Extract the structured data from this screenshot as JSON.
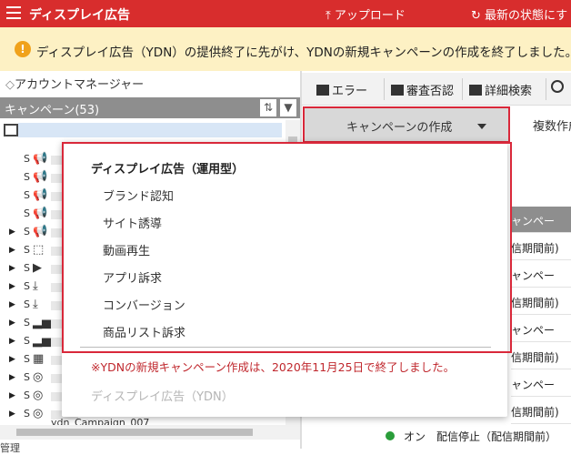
{
  "header": {
    "title": "ディスプレイ広告",
    "upload_label": "アップロード",
    "refresh_label": "最新の状態にす"
  },
  "notice": {
    "text": "ディスプレイ広告（YDN）の提供終了に先がけ、YDNの新規キャンペーンの作成を終了しました。入"
  },
  "sidebar": {
    "account_label": "アカウントマネージャー",
    "campaigns_label": "キャンペーン(53)",
    "footer_label": "管理"
  },
  "tree_rows": [
    {
      "expand": "",
      "prefix": "S",
      "icon": "megaphone"
    },
    {
      "expand": "",
      "prefix": "S",
      "icon": "megaphone"
    },
    {
      "expand": "",
      "prefix": "S",
      "icon": "megaphone"
    },
    {
      "expand": "",
      "prefix": "S",
      "icon": "megaphone"
    },
    {
      "expand": "▶",
      "prefix": "S",
      "icon": "megaphone"
    },
    {
      "expand": "▶",
      "prefix": "S",
      "icon": "cursor"
    },
    {
      "expand": "▶",
      "prefix": "S",
      "icon": "play"
    },
    {
      "expand": "▶",
      "prefix": "S",
      "icon": "download"
    },
    {
      "expand": "▶",
      "prefix": "S",
      "icon": "download"
    },
    {
      "expand": "▶",
      "prefix": "S",
      "icon": "bar-chart"
    },
    {
      "expand": "▶",
      "prefix": "S",
      "icon": "bar-chart"
    },
    {
      "expand": "▶",
      "prefix": "S",
      "icon": "grid"
    },
    {
      "expand": "▶",
      "prefix": "S",
      "icon": "target"
    },
    {
      "expand": "▶",
      "prefix": "S",
      "icon": "target"
    },
    {
      "expand": "▶",
      "prefix": "S",
      "icon": "target"
    }
  ],
  "tree_last_label": "ydn_Campaign_007",
  "toolbar": {
    "error_label": "エラー",
    "review_label": "審査否認",
    "detail_search_label": "詳細検索"
  },
  "create_button": {
    "label": "キャンペーンの作成"
  },
  "multi_label": "複数作成",
  "right_column": [
    {
      "text": "ャンペー",
      "header": true
    },
    {
      "text": "信期間前)",
      "header": false
    },
    {
      "text": "ャンペー",
      "header": false
    },
    {
      "text": "信期間前)",
      "header": false
    },
    {
      "text": "ャンペー",
      "header": false
    },
    {
      "text": "信期間前)",
      "header": false
    },
    {
      "text": "ャンペー",
      "header": false
    },
    {
      "text": "信期間前)",
      "header": false
    }
  ],
  "status_row": {
    "on_label": "オン",
    "status_text": "配信停止（配信期間前）"
  },
  "dropdown": {
    "heading": "ディスプレイ広告（運用型）",
    "items": [
      "ブランド認知",
      "サイト誘導",
      "動画再生",
      "アプリ訴求",
      "コンバージョン",
      "商品リスト訴求"
    ],
    "note": "※YDNの新規キャンペーン作成は、2020年11月25日で終了しました。",
    "disabled_label": "ディスプレイ広告（YDN）"
  },
  "colors": {
    "brand": "#d82d2d",
    "notice_bg": "#fdf1c4",
    "highlight": "#d9283a",
    "note_text": "#c0282e"
  }
}
